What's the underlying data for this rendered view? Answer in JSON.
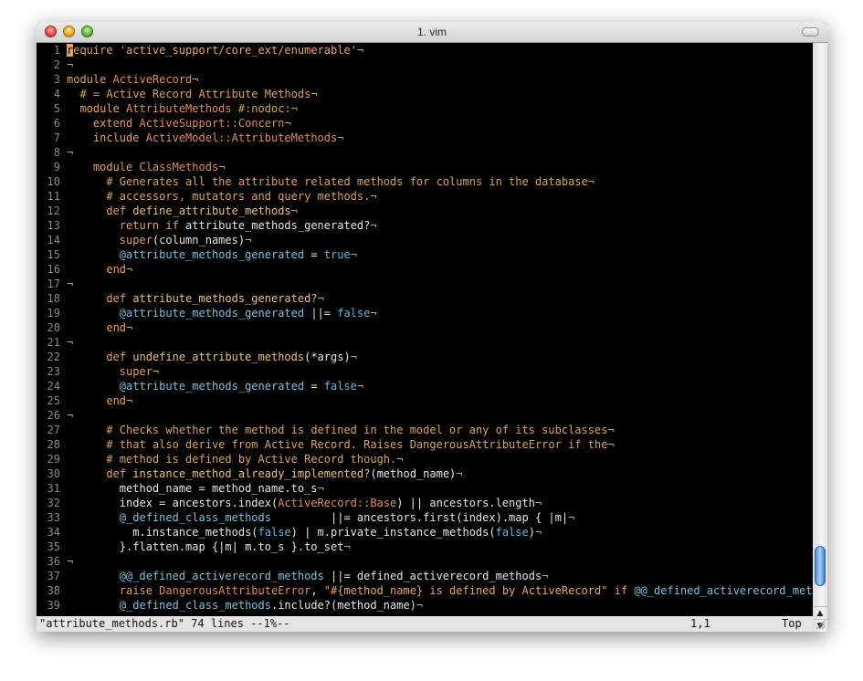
{
  "window": {
    "title": "1. vim"
  },
  "colors": {
    "keyword": "#e2a25e",
    "comment": "#d9a45a",
    "string": "#e8a56a",
    "constant": "#e08a5e",
    "function": "#e8c27a",
    "boolean": "#6cb5d4",
    "ivar": "#7fc0d8",
    "eol": "#c0a868"
  },
  "editor": {
    "lines": [
      [
        [
          "k",
          "r"
        ],
        [
          "k",
          "equire "
        ],
        [
          "s",
          "'active_support/core_ext/enumerable'"
        ],
        [
          "n",
          "¬"
        ]
      ],
      [
        [
          "n",
          "¬"
        ]
      ],
      [
        [
          "k",
          "module "
        ],
        [
          "t",
          "ActiveRecord"
        ],
        [
          "n",
          "¬"
        ]
      ],
      [
        [
          "p",
          "  "
        ],
        [
          "c",
          "# = Active Record Attribute Methods"
        ],
        [
          "n",
          "¬"
        ]
      ],
      [
        [
          "p",
          "  "
        ],
        [
          "k",
          "module "
        ],
        [
          "t",
          "AttributeMethods"
        ],
        [
          "c",
          " #:nodoc:"
        ],
        [
          "n",
          "¬"
        ]
      ],
      [
        [
          "p",
          "    "
        ],
        [
          "k",
          "extend "
        ],
        [
          "t",
          "ActiveSupport::Concern"
        ],
        [
          "n",
          "¬"
        ]
      ],
      [
        [
          "p",
          "    "
        ],
        [
          "k",
          "include "
        ],
        [
          "t",
          "ActiveModel::AttributeMethods"
        ],
        [
          "n",
          "¬"
        ]
      ],
      [
        [
          "n",
          "¬"
        ]
      ],
      [
        [
          "p",
          "    "
        ],
        [
          "k",
          "module "
        ],
        [
          "t",
          "ClassMethods"
        ],
        [
          "n",
          "¬"
        ]
      ],
      [
        [
          "p",
          "      "
        ],
        [
          "c",
          "# Generates all the attribute related methods for columns in the database"
        ],
        [
          "n",
          "¬"
        ]
      ],
      [
        [
          "p",
          "      "
        ],
        [
          "c",
          "# accessors, mutators and query methods."
        ],
        [
          "n",
          "¬"
        ]
      ],
      [
        [
          "p",
          "      "
        ],
        [
          "k",
          "def "
        ],
        [
          "f",
          "define_attribute_methods"
        ],
        [
          "n",
          "¬"
        ]
      ],
      [
        [
          "p",
          "        "
        ],
        [
          "k",
          "return if "
        ],
        [
          "p",
          "attribute_methods_generated?"
        ],
        [
          "n",
          "¬"
        ]
      ],
      [
        [
          "p",
          "        "
        ],
        [
          "k",
          "super"
        ],
        [
          "p",
          "(column_names)"
        ],
        [
          "n",
          "¬"
        ]
      ],
      [
        [
          "p",
          "        "
        ],
        [
          "v",
          "@attribute_methods_generated"
        ],
        [
          "p",
          " = "
        ],
        [
          "b",
          "true"
        ],
        [
          "n",
          "¬"
        ]
      ],
      [
        [
          "p",
          "      "
        ],
        [
          "k",
          "end"
        ],
        [
          "n",
          "¬"
        ]
      ],
      [
        [
          "n",
          "¬"
        ]
      ],
      [
        [
          "p",
          "      "
        ],
        [
          "k",
          "def "
        ],
        [
          "f",
          "attribute_methods_generated?"
        ],
        [
          "n",
          "¬"
        ]
      ],
      [
        [
          "p",
          "        "
        ],
        [
          "v",
          "@attribute_methods_generated"
        ],
        [
          "p",
          " ||= "
        ],
        [
          "b",
          "false"
        ],
        [
          "n",
          "¬"
        ]
      ],
      [
        [
          "p",
          "      "
        ],
        [
          "k",
          "end"
        ],
        [
          "n",
          "¬"
        ]
      ],
      [
        [
          "n",
          "¬"
        ]
      ],
      [
        [
          "p",
          "      "
        ],
        [
          "k",
          "def "
        ],
        [
          "f",
          "undefine_attribute_methods"
        ],
        [
          "p",
          "(*args)"
        ],
        [
          "n",
          "¬"
        ]
      ],
      [
        [
          "p",
          "        "
        ],
        [
          "k",
          "super"
        ],
        [
          "n",
          "¬"
        ]
      ],
      [
        [
          "p",
          "        "
        ],
        [
          "v",
          "@attribute_methods_generated"
        ],
        [
          "p",
          " = "
        ],
        [
          "b",
          "false"
        ],
        [
          "n",
          "¬"
        ]
      ],
      [
        [
          "p",
          "      "
        ],
        [
          "k",
          "end"
        ],
        [
          "n",
          "¬"
        ]
      ],
      [
        [
          "n",
          "¬"
        ]
      ],
      [
        [
          "p",
          "      "
        ],
        [
          "c",
          "# Checks whether the method is defined in the model or any of its subclasses"
        ],
        [
          "n",
          "¬"
        ]
      ],
      [
        [
          "p",
          "      "
        ],
        [
          "c",
          "# that also derive from Active Record. Raises DangerousAttributeError if the"
        ],
        [
          "n",
          "¬"
        ]
      ],
      [
        [
          "p",
          "      "
        ],
        [
          "c",
          "# method is defined by Active Record though."
        ],
        [
          "n",
          "¬"
        ]
      ],
      [
        [
          "p",
          "      "
        ],
        [
          "k",
          "def "
        ],
        [
          "f",
          "instance_method_already_implemented?"
        ],
        [
          "p",
          "(method_name)"
        ],
        [
          "n",
          "¬"
        ]
      ],
      [
        [
          "p",
          "        method_name = method_name.to_s"
        ],
        [
          "n",
          "¬"
        ]
      ],
      [
        [
          "p",
          "        index = ancestors.index("
        ],
        [
          "t",
          "ActiveRecord::Base"
        ],
        [
          "p",
          ") || ancestors.length"
        ],
        [
          "n",
          "¬"
        ]
      ],
      [
        [
          "p",
          "        "
        ],
        [
          "v",
          "@_defined_class_methods"
        ],
        [
          "p",
          "         ||= ancestors.first(index).map { |m|"
        ],
        [
          "n",
          "¬"
        ]
      ],
      [
        [
          "p",
          "          m.instance_methods("
        ],
        [
          "b",
          "false"
        ],
        [
          "p",
          ") | m.private_instance_methods("
        ],
        [
          "b",
          "false"
        ],
        [
          "p",
          ")"
        ],
        [
          "n",
          "¬"
        ]
      ],
      [
        [
          "p",
          "        }.flatten.map {|m| m.to_s }.to_set"
        ],
        [
          "n",
          "¬"
        ]
      ],
      [
        [
          "n",
          "¬"
        ]
      ],
      [
        [
          "p",
          "        "
        ],
        [
          "v",
          "@@_defined_activerecord_methods"
        ],
        [
          "p",
          " ||= defined_activerecord_methods"
        ],
        [
          "n",
          "¬"
        ]
      ],
      [
        [
          "p",
          "        "
        ],
        [
          "k",
          "raise "
        ],
        [
          "t",
          "DangerousAttributeError"
        ],
        [
          "p",
          ", "
        ],
        [
          "s",
          "\"#{method_name} is defined by ActiveRecord\""
        ],
        [
          "k",
          " if "
        ],
        [
          "v",
          "@@_defined_activerecord_method"
        ]
      ],
      [
        [
          "p",
          "        "
        ],
        [
          "v",
          "@_defined_class_methods"
        ],
        [
          "p",
          ".include?(method_name)"
        ],
        [
          "n",
          "¬"
        ]
      ]
    ]
  },
  "status": {
    "file_info": "\"attribute_methods.rb\" 74 lines --1%--",
    "position": "1,1",
    "percent": "Top"
  },
  "scrollbar": {
    "arrow_up": "▲",
    "arrow_down": "▼"
  }
}
